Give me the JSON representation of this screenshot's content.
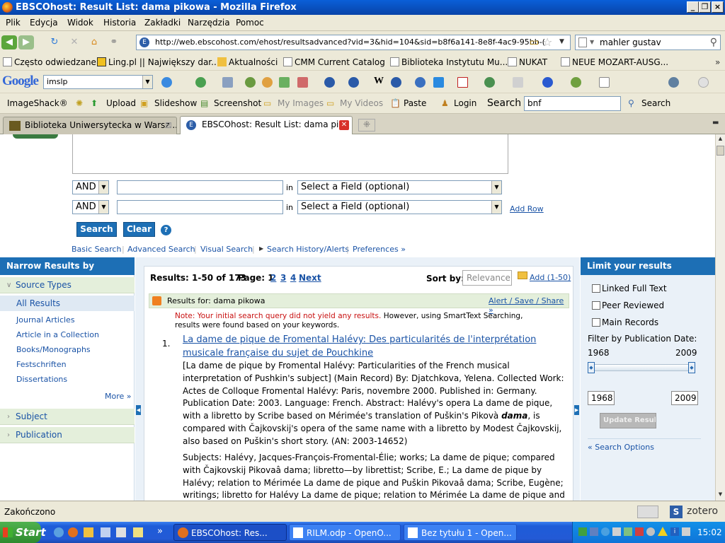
{
  "window": {
    "title": "EBSCOhost: Result List: dama pikowa - Mozilla Firefox"
  },
  "menu": [
    "Plik",
    "Edycja",
    "Widok",
    "Historia",
    "Zakładki",
    "Narzędzia",
    "Pomoc"
  ],
  "url": "http://web.ebscohost.com/ehost/resultsadvanced?vid=3&hid=104&sid=b8f6a141-8e8f-4ac9-95bb-(",
  "firefox_search": "mahler gustav",
  "bookmarks": [
    "Często odwiedzane",
    "Ling.pl || Największy dar...",
    "Aktualności",
    "CMM Current Catalog",
    "Biblioteka Instytutu Mu...",
    "NUKAT",
    "NEUE MOZART-AUSG..."
  ],
  "google": {
    "logo": "Google",
    "query": "imslp"
  },
  "imageshack": {
    "brand": "ImageShack®",
    "upload": "Upload",
    "slideshow": "Slideshow",
    "screenshot": "Screenshot",
    "my_images": "My Images",
    "my_videos": "My Videos",
    "paste": "Paste",
    "login": "Login",
    "search_label": "Search",
    "search_value": "bnf",
    "search_btn": "Search"
  },
  "tabs": [
    {
      "label": "Biblioteka Uniwersytecka w Warsz..."
    },
    {
      "label": "EBSCOhost: Result List: dama pi..."
    }
  ],
  "search_form": {
    "rows": [
      {
        "op": "AND",
        "in": "in",
        "field": "Select a Field (optional)"
      },
      {
        "op": "AND",
        "in": "in",
        "field": "Select a Field (optional)"
      }
    ],
    "add_row": "Add Row",
    "search_btn": "Search",
    "clear_btn": "Clear",
    "help": "?",
    "links": [
      "Basic Search",
      "Advanced Search",
      "Visual Search",
      "Search History/Alerts",
      "Preferences »"
    ]
  },
  "narrow": {
    "header": "Narrow Results by",
    "source_types": "Source Types",
    "items": [
      "All Results",
      "Journal Articles",
      "Article in a Collection",
      "Books/Monographs",
      "Festschriften",
      "Dissertations"
    ],
    "more": "More »",
    "subject": "Subject",
    "publication": "Publication"
  },
  "results": {
    "summary": "Results: 1-50 of 173",
    "page_label": "Page: 1",
    "pages": [
      "2",
      "3",
      "4"
    ],
    "next": "Next",
    "sort_label": "Sort by:",
    "sort_value": "Relevance",
    "add": "Add (1-50)",
    "results_for": "Results for:  dama pikowa",
    "alert": "Alert / Save / Share »",
    "note_red": "Note: Your initial search query did not yield any results.",
    "note_black": " However, using SmartText Searching, results were found based on your keywords.",
    "item_number": "1.",
    "item_title": "La dame de pique de Fromental Halévy: Des particularités de l'interprétation musicale française du sujet de Pouchkine",
    "item_body_pre": "[La dame de pique by Fromental Halévy: Particularities of the French musical interpretation of Pushkin's subject] (Main Record) By: Djatchkova, Yelena. Collected Work: Actes de Colloque Fromental Halévy: Paris, novembre 2000. Published in: Germany. Publication Date: 2003. Language: French. Abstract: Halévy's opera La dame de pique, with a libretto by Scribe based on Mérimée's translation of Puškin's Pikovà ",
    "item_body_em": "dama",
    "item_body_post": ", is compared with Čajkovskij's opera of the same name with a libretto by Modest Čajkovskij, also based on Puškin's short story. (AN: 2003-14652)",
    "item_subjects": "Subjects: Halévy, Jacques-François-Fromental-Élie; works; La dame de pique; compared with Čajkovskij Pikovaâ dama; libretto—by librettist; Scribe, E.; La dame de pique by Halévy; relation to Mérimée La dame de pique and Puškin Pikovaâ dama; Scribe, Eugène; writings; libretto for Halévy La dame de pique; relation to Mérimée La dame de pique and Puškin"
  },
  "limit": {
    "header": "Limit your results",
    "options": [
      "Linked Full Text",
      "Peer Reviewed",
      "Main Records"
    ],
    "filter_label": "Filter by Publication Date:",
    "from": "1968",
    "to": "2009",
    "update": "Update Results",
    "search_options": "« Search Options"
  },
  "status": {
    "text": "Zakończono",
    "zotero": "zotero"
  },
  "taskbar": {
    "start": "Start",
    "items": [
      "EBSCOhost: Res...",
      "RILM.odp - OpenO...",
      "Bez tytułu 1 - Open..."
    ],
    "clock": "15:02"
  },
  "colors": {
    "ebsco_blue": "#1d6fb5",
    "titlebar": "#0a5fd8",
    "green_row": "#e4efdb"
  }
}
